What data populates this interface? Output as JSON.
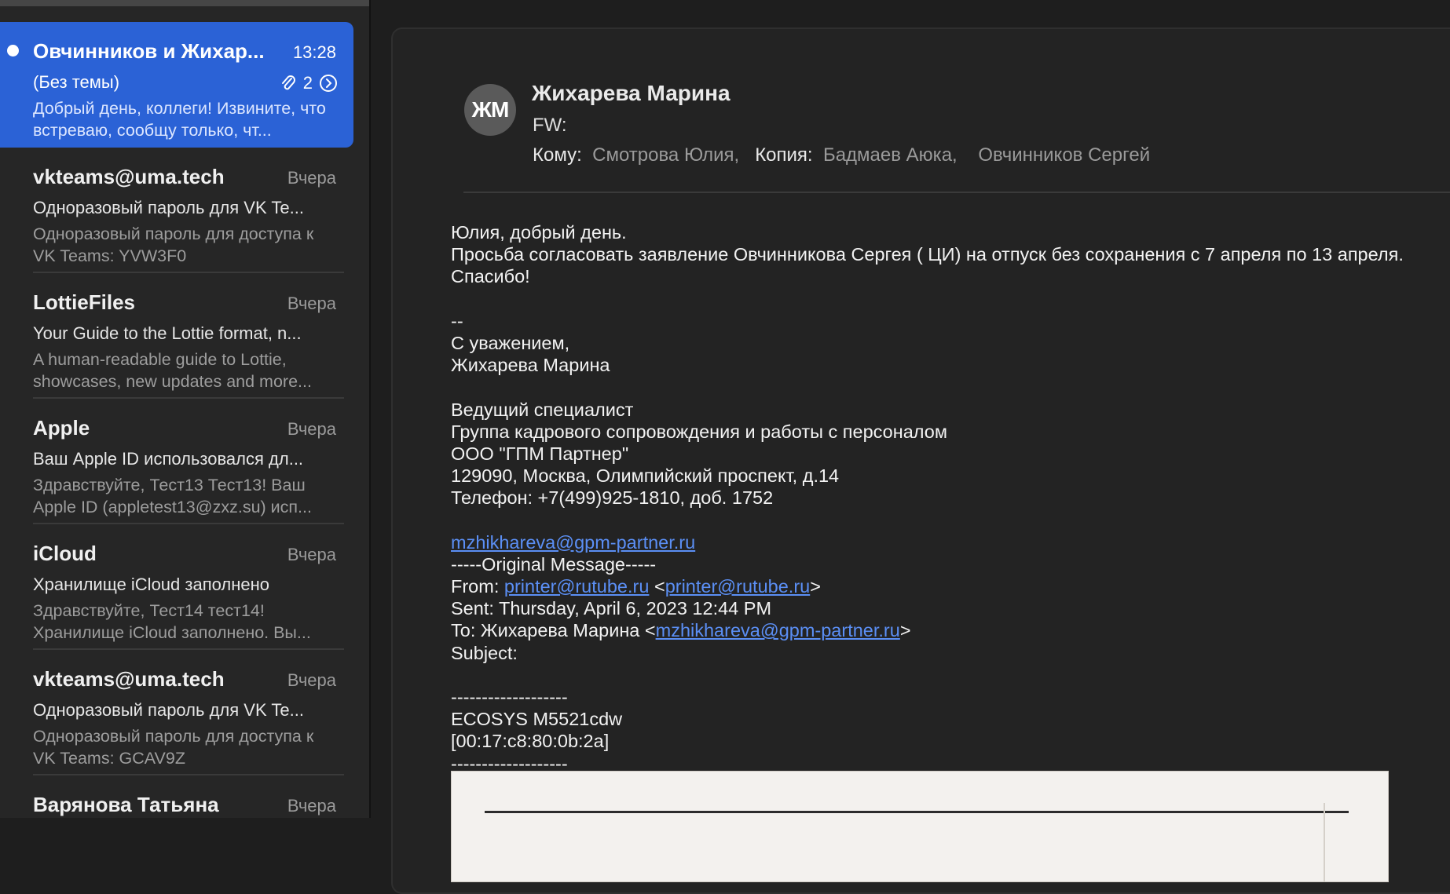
{
  "message_list": [
    {
      "sender": "Овчинников и Жихар...",
      "time": "13:28",
      "subject": "(Без темы)",
      "preview": "Добрый день, коллеги! Извините, что встреваю, сообщу только, чт...",
      "unread": true,
      "selected": true,
      "has_attachment": true,
      "thread_count": "2"
    },
    {
      "sender": "vkteams@uma.tech",
      "time": "Вчера",
      "subject": "Одноразовый пароль для VK Te...",
      "preview": "Одноразовый пароль для доступа к VK Teams: YVW3F0"
    },
    {
      "sender": "LottieFiles",
      "time": "Вчера",
      "subject": "Your Guide to the Lottie format, n...",
      "preview": "A human-readable guide to Lottie, showcases, new updates and more..."
    },
    {
      "sender": "Apple",
      "time": "Вчера",
      "subject": "Ваш Apple ID использовался дл...",
      "preview": "Здравствуйте, Тест13 Тест13! Ваш Apple ID (appletest13@zxz.su) исп..."
    },
    {
      "sender": "iCloud",
      "time": "Вчера",
      "subject": "Хранилище iCloud заполнено",
      "preview": "Здравствуйте, Тест14 тест14! Хранилище iCloud заполнено. Вы..."
    },
    {
      "sender": "vkteams@uma.tech",
      "time": "Вчера",
      "subject": "Одноразовый пароль для VK Te...",
      "preview": "Одноразовый пароль для доступа к VK Teams: GCAV9Z"
    },
    {
      "sender": "Варянова Татьяна",
      "time": "Вчера",
      "subject": "",
      "preview": ""
    }
  ],
  "message": {
    "avatar_initials": "ЖМ",
    "sender": "Жихарева Марина",
    "subject": "FW:",
    "to_label": "Кому:",
    "to": "Смотрова Юлия,",
    "cc_label": "Копия:",
    "cc_1": "Бадмаев Аюка,",
    "cc_2": "Овчинников Сергей",
    "body": {
      "greeting": "Юлия, добрый день.",
      "request": "Просьба согласовать заявление Овчинникова Сергея ( ЦИ) на отпуск без сохранения с 7 апреля по 13 апреля.",
      "thanks": "Спасибо!",
      "sig_dash": "--",
      "sig_regards": "С уважением,",
      "sig_name": "Жихарева Марина",
      "sig_title": "Ведущий специалист",
      "sig_group": "Группа кадрового сопровождения и работы с персоналом",
      "sig_company": "ООО \"ГПМ Партнер\"",
      "sig_address": "129090, Москва, Олимпийский проспект, д.14",
      "sig_phone": "Телефон: +7(499)925-1810, доб. 1752",
      "sig_email": "mzhikhareva@gpm-partner.ru",
      "original_header": "-----Original Message-----",
      "from_label": "From: ",
      "from_link": "printer@rutube.ru",
      "from_bracket_open": " <",
      "from_link_2": "printer@rutube.ru",
      "from_bracket_close": ">",
      "sent": "Sent: Thursday, April 6, 2023 12:44 PM",
      "to_prefix": "To: Жихарева Марина <",
      "to_link": "mzhikhareva@gpm-partner.ru",
      "to_bracket_close": ">",
      "subject_line": "Subject:",
      "sep_1": "-------------------",
      "device": "ECOSYS M5521cdw",
      "mac": "[00:17:c8:80:0b:2a]",
      "sep_2": "-------------------"
    }
  },
  "colors": {
    "selected_bg": "#2b62d6",
    "link": "#5b8ff5",
    "pane_bg": "#262626",
    "reading_bg": "#1e1e1e"
  }
}
